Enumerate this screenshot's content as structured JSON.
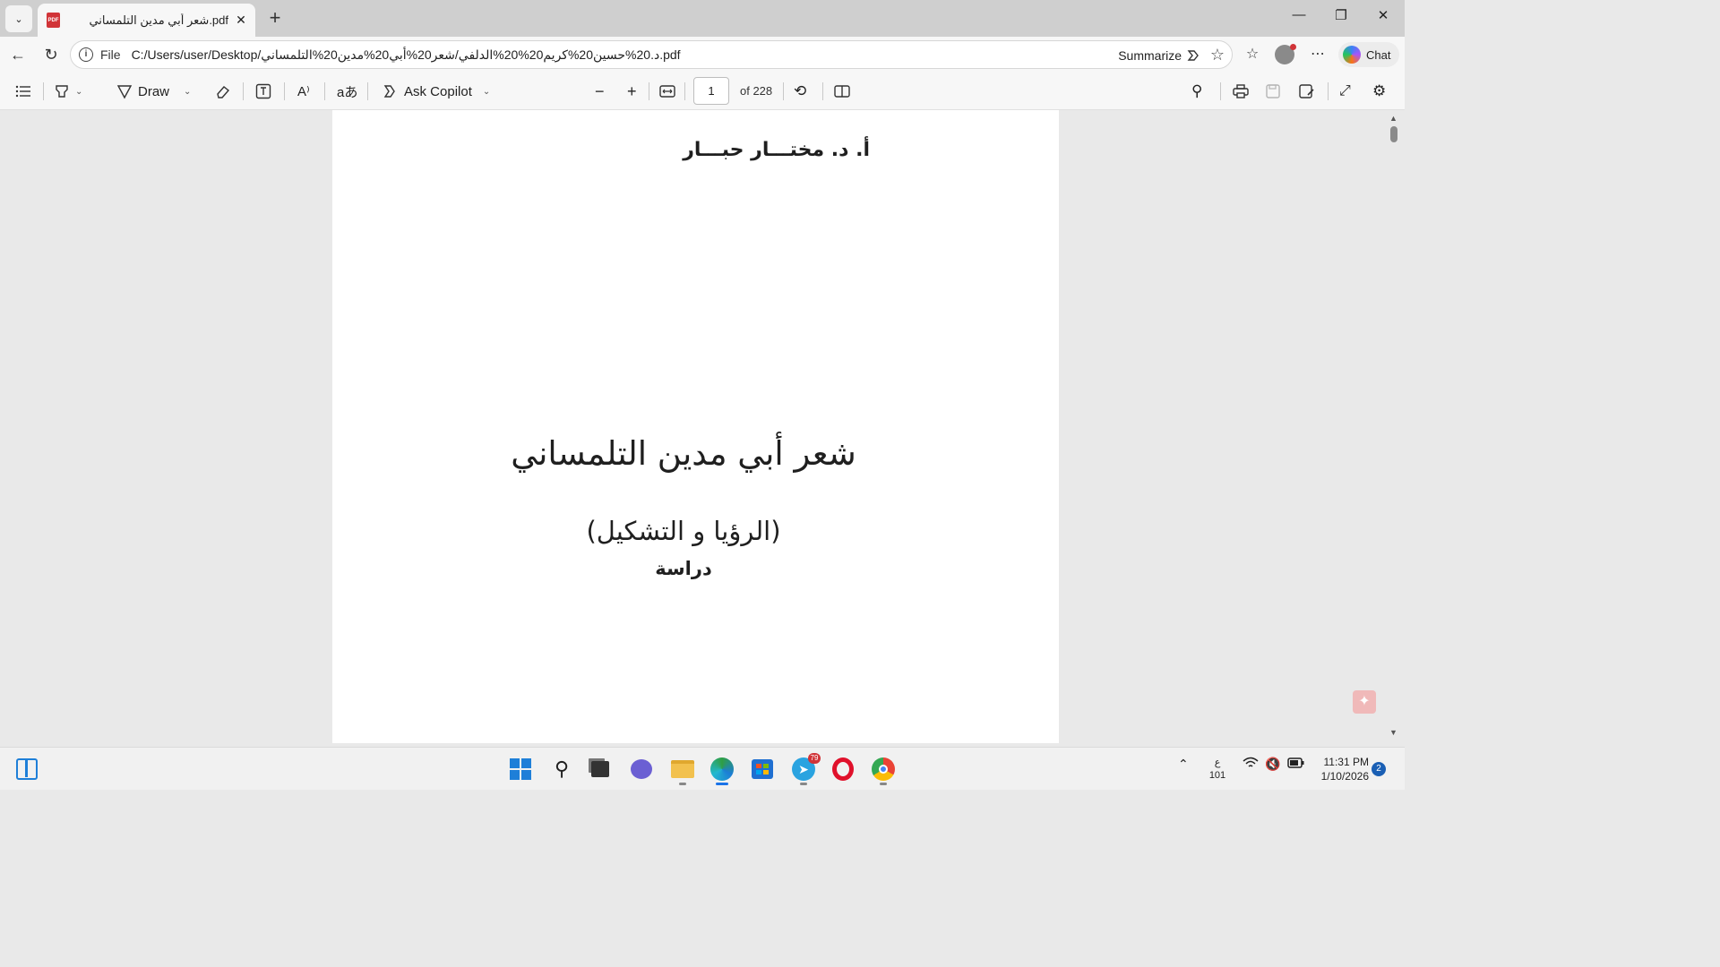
{
  "browser": {
    "tab": {
      "title": "شعر أبي مدين التلمساني.pdf",
      "icon": "pdf-icon",
      "badge_text": "PDF"
    },
    "address": {
      "scheme_label": "File",
      "url": "C:/Users/user/Desktop/د.20%حسين20%كريم20%20%الدلفي/شعر20%أبي20%مدين20%التلمساني.pdf",
      "summarize_label": "Summarize"
    },
    "chat_label": "Chat"
  },
  "pdf_toolbar": {
    "draw_label": "Draw",
    "ask_copilot_label": "Ask Copilot",
    "page_current": "1",
    "page_total_label": "of 228"
  },
  "document": {
    "author": "أ. د. مختـــار حبـــار",
    "title": "شعر أبي مدين التلمساني",
    "subtitle": "(الرؤيا و التشكيل)",
    "genre": "دراسة"
  },
  "taskbar": {
    "telegram_badge": "79",
    "lang_top": "ع",
    "lang_bottom": "101",
    "time": "11:31 PM",
    "date": "1/10/2026",
    "notifications": "2"
  },
  "colors": {
    "accent": "#1a73e8",
    "pdf_red": "#d13438"
  }
}
